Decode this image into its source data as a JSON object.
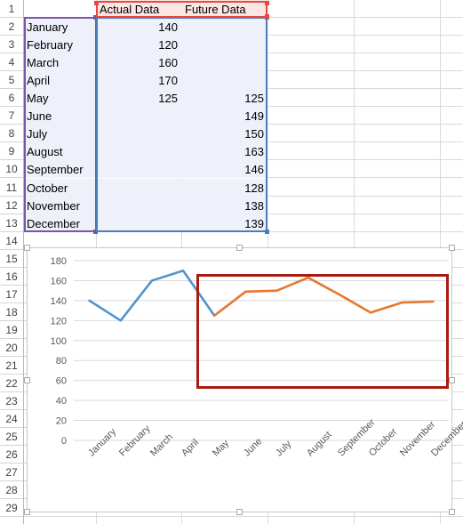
{
  "app": {
    "type": "spreadsheet"
  },
  "grid": {
    "row_headers": [
      "1",
      "2",
      "3",
      "4",
      "5",
      "6",
      "7",
      "8",
      "9",
      "10",
      "11",
      "12",
      "13",
      "14",
      "15",
      "16",
      "17",
      "18",
      "19",
      "20",
      "21",
      "22",
      "23",
      "24",
      "25",
      "26",
      "27",
      "28",
      "29"
    ],
    "header_row": {
      "a": "",
      "b": "Actual Data",
      "c": "Future Data"
    },
    "rows": [
      {
        "row": "2",
        "month": "January",
        "actual": "140",
        "future": ""
      },
      {
        "row": "3",
        "month": "February",
        "actual": "120",
        "future": ""
      },
      {
        "row": "4",
        "month": "March",
        "actual": "160",
        "future": ""
      },
      {
        "row": "5",
        "month": "April",
        "actual": "170",
        "future": ""
      },
      {
        "row": "6",
        "month": "May",
        "actual": "125",
        "future": "125"
      },
      {
        "row": "7",
        "month": "June",
        "actual": "",
        "future": "149"
      },
      {
        "row": "8",
        "month": "July",
        "actual": "",
        "future": "150"
      },
      {
        "row": "9",
        "month": "August",
        "actual": "",
        "future": "163"
      },
      {
        "row": "10",
        "month": "September",
        "actual": "",
        "future": "146"
      },
      {
        "row": "11",
        "month": "October",
        "actual": "",
        "future": "128"
      },
      {
        "row": "12",
        "month": "November",
        "actual": "",
        "future": "138"
      },
      {
        "row": "13",
        "month": "December",
        "actual": "",
        "future": "139"
      }
    ]
  },
  "selection": {
    "category_range_color": "#7a56a6",
    "value_range_color": "#4a7ebb",
    "label_range_color": "#e8473f"
  },
  "annotation": {
    "shape": "rectangle",
    "color": "#a81b12",
    "covers": "Future Data series region"
  },
  "chart_data": {
    "type": "line",
    "title": "",
    "xlabel": "",
    "ylabel": "",
    "categories": [
      "January",
      "February",
      "March",
      "April",
      "May",
      "June",
      "July",
      "August",
      "September",
      "October",
      "November",
      "December"
    ],
    "series": [
      {
        "name": "Actual Data",
        "color": "#4f94cd",
        "values": [
          140,
          120,
          160,
          170,
          125,
          null,
          null,
          null,
          null,
          null,
          null,
          null
        ]
      },
      {
        "name": "Future Data",
        "color": "#e8762c",
        "values": [
          null,
          null,
          null,
          null,
          125,
          149,
          150,
          163,
          146,
          128,
          138,
          139
        ]
      }
    ],
    "ylim": [
      0,
      180
    ],
    "ytick_step": 20,
    "yticks": [
      "180",
      "160",
      "140",
      "120",
      "100",
      "80",
      "60",
      "40",
      "20",
      "0"
    ],
    "grid": true,
    "legend": "none",
    "xlabel_rotation": -45
  }
}
